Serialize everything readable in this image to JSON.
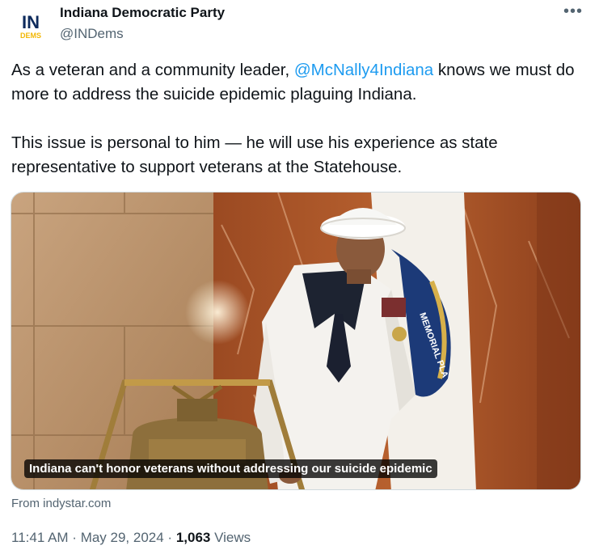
{
  "author": {
    "name": "Indiana Democratic Party",
    "handle": "@INDems",
    "avatar_logo": "IN",
    "avatar_sub": "DEMS"
  },
  "more_icon": "more-horizontal-icon",
  "tweet": {
    "p1_before": "As a veteran and a community leader, ",
    "p1_mention": "@McNally4Indiana",
    "p1_after": " knows we must do more to address the suicide epidemic plaguing Indiana.",
    "p2": "This issue is personal to him — he will use his experience as state representative to support veterans at the Statehouse."
  },
  "card": {
    "caption": "Indiana can't honor veterans without addressing our suicide epidemic",
    "source": "From indystar.com",
    "flag_text": "MEMORIAL PLA"
  },
  "meta": {
    "time": "11:41 AM",
    "separator": " · ",
    "date": "May 29, 2024",
    "views_count": "1,063",
    "views_label": " Views"
  },
  "colors": {
    "accent": "#1d9bf0",
    "secondary_text": "#536471",
    "primary_text": "#0f1419",
    "logo_navy": "#0d2a5c",
    "logo_gold": "#f2b705"
  }
}
